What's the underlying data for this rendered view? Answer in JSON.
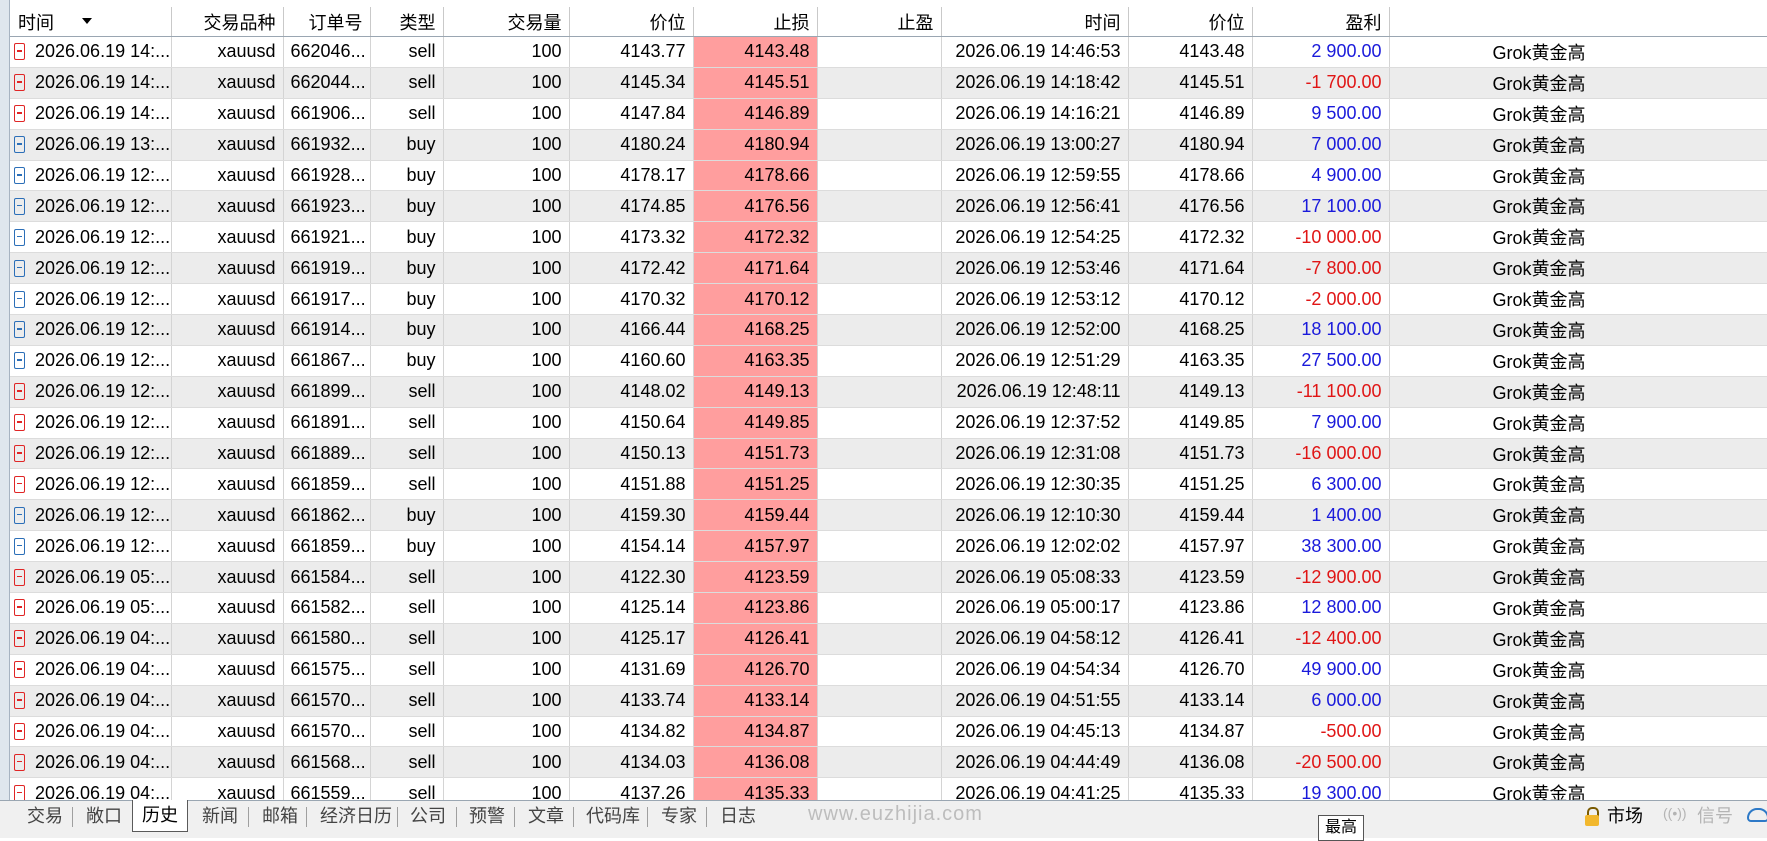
{
  "columns": [
    "时间",
    "交易品种",
    "订单号",
    "类型",
    "交易量",
    "价位",
    "止损",
    "止盈",
    "时间",
    "价位",
    "盈利",
    ""
  ],
  "rows": [
    {
      "open_time": "2026.06.19 14:...",
      "symbol": "xauusd",
      "order": "662046...",
      "type": "sell",
      "volume": "100",
      "open_price": "4143.77",
      "sl": "4143.48",
      "tp": "",
      "close_time": "2026.06.19 14:46:53",
      "close_price": "4143.48",
      "profit": "2 900.00",
      "profit_sign": "pos",
      "comment": "Grok黄金高"
    },
    {
      "open_time": "2026.06.19 14:...",
      "symbol": "xauusd",
      "order": "662044...",
      "type": "sell",
      "volume": "100",
      "open_price": "4145.34",
      "sl": "4145.51",
      "tp": "",
      "close_time": "2026.06.19 14:18:42",
      "close_price": "4145.51",
      "profit": "-1 700.00",
      "profit_sign": "neg",
      "comment": "Grok黄金高"
    },
    {
      "open_time": "2026.06.19 14:...",
      "symbol": "xauusd",
      "order": "661906...",
      "type": "sell",
      "volume": "100",
      "open_price": "4147.84",
      "sl": "4146.89",
      "tp": "",
      "close_time": "2026.06.19 14:16:21",
      "close_price": "4146.89",
      "profit": "9 500.00",
      "profit_sign": "pos",
      "comment": "Grok黄金高"
    },
    {
      "open_time": "2026.06.19 13:...",
      "symbol": "xauusd",
      "order": "661932...",
      "type": "buy",
      "volume": "100",
      "open_price": "4180.24",
      "sl": "4180.94",
      "tp": "",
      "close_time": "2026.06.19 13:00:27",
      "close_price": "4180.94",
      "profit": "7 000.00",
      "profit_sign": "pos",
      "comment": "Grok黄金高"
    },
    {
      "open_time": "2026.06.19 12:...",
      "symbol": "xauusd",
      "order": "661928...",
      "type": "buy",
      "volume": "100",
      "open_price": "4178.17",
      "sl": "4178.66",
      "tp": "",
      "close_time": "2026.06.19 12:59:55",
      "close_price": "4178.66",
      "profit": "4 900.00",
      "profit_sign": "pos",
      "comment": "Grok黄金高"
    },
    {
      "open_time": "2026.06.19 12:...",
      "symbol": "xauusd",
      "order": "661923...",
      "type": "buy",
      "volume": "100",
      "open_price": "4174.85",
      "sl": "4176.56",
      "tp": "",
      "close_time": "2026.06.19 12:56:41",
      "close_price": "4176.56",
      "profit": "17 100.00",
      "profit_sign": "pos",
      "comment": "Grok黄金高"
    },
    {
      "open_time": "2026.06.19 12:...",
      "symbol": "xauusd",
      "order": "661921...",
      "type": "buy",
      "volume": "100",
      "open_price": "4173.32",
      "sl": "4172.32",
      "tp": "",
      "close_time": "2026.06.19 12:54:25",
      "close_price": "4172.32",
      "profit": "-10 000.00",
      "profit_sign": "neg",
      "comment": "Grok黄金高"
    },
    {
      "open_time": "2026.06.19 12:...",
      "symbol": "xauusd",
      "order": "661919...",
      "type": "buy",
      "volume": "100",
      "open_price": "4172.42",
      "sl": "4171.64",
      "tp": "",
      "close_time": "2026.06.19 12:53:46",
      "close_price": "4171.64",
      "profit": "-7 800.00",
      "profit_sign": "neg",
      "comment": "Grok黄金高"
    },
    {
      "open_time": "2026.06.19 12:...",
      "symbol": "xauusd",
      "order": "661917...",
      "type": "buy",
      "volume": "100",
      "open_price": "4170.32",
      "sl": "4170.12",
      "tp": "",
      "close_time": "2026.06.19 12:53:12",
      "close_price": "4170.12",
      "profit": "-2 000.00",
      "profit_sign": "neg",
      "comment": "Grok黄金高"
    },
    {
      "open_time": "2026.06.19 12:...",
      "symbol": "xauusd",
      "order": "661914...",
      "type": "buy",
      "volume": "100",
      "open_price": "4166.44",
      "sl": "4168.25",
      "tp": "",
      "close_time": "2026.06.19 12:52:00",
      "close_price": "4168.25",
      "profit": "18 100.00",
      "profit_sign": "pos",
      "comment": "Grok黄金高"
    },
    {
      "open_time": "2026.06.19 12:...",
      "symbol": "xauusd",
      "order": "661867...",
      "type": "buy",
      "volume": "100",
      "open_price": "4160.60",
      "sl": "4163.35",
      "tp": "",
      "close_time": "2026.06.19 12:51:29",
      "close_price": "4163.35",
      "profit": "27 500.00",
      "profit_sign": "pos",
      "comment": "Grok黄金高"
    },
    {
      "open_time": "2026.06.19 12:...",
      "symbol": "xauusd",
      "order": "661899...",
      "type": "sell",
      "volume": "100",
      "open_price": "4148.02",
      "sl": "4149.13",
      "tp": "",
      "close_time": "2026.06.19 12:48:11",
      "close_price": "4149.13",
      "profit": "-11 100.00",
      "profit_sign": "neg",
      "comment": "Grok黄金高"
    },
    {
      "open_time": "2026.06.19 12:...",
      "symbol": "xauusd",
      "order": "661891...",
      "type": "sell",
      "volume": "100",
      "open_price": "4150.64",
      "sl": "4149.85",
      "tp": "",
      "close_time": "2026.06.19 12:37:52",
      "close_price": "4149.85",
      "profit": "7 900.00",
      "profit_sign": "pos",
      "comment": "Grok黄金高"
    },
    {
      "open_time": "2026.06.19 12:...",
      "symbol": "xauusd",
      "order": "661889...",
      "type": "sell",
      "volume": "100",
      "open_price": "4150.13",
      "sl": "4151.73",
      "tp": "",
      "close_time": "2026.06.19 12:31:08",
      "close_price": "4151.73",
      "profit": "-16 000.00",
      "profit_sign": "neg",
      "comment": "Grok黄金高"
    },
    {
      "open_time": "2026.06.19 12:...",
      "symbol": "xauusd",
      "order": "661859...",
      "type": "sell",
      "volume": "100",
      "open_price": "4151.88",
      "sl": "4151.25",
      "tp": "",
      "close_time": "2026.06.19 12:30:35",
      "close_price": "4151.25",
      "profit": "6 300.00",
      "profit_sign": "pos",
      "comment": "Grok黄金高"
    },
    {
      "open_time": "2026.06.19 12:...",
      "symbol": "xauusd",
      "order": "661862...",
      "type": "buy",
      "volume": "100",
      "open_price": "4159.30",
      "sl": "4159.44",
      "tp": "",
      "close_time": "2026.06.19 12:10:30",
      "close_price": "4159.44",
      "profit": "1 400.00",
      "profit_sign": "pos",
      "comment": "Grok黄金高"
    },
    {
      "open_time": "2026.06.19 12:...",
      "symbol": "xauusd",
      "order": "661859...",
      "type": "buy",
      "volume": "100",
      "open_price": "4154.14",
      "sl": "4157.97",
      "tp": "",
      "close_time": "2026.06.19 12:02:02",
      "close_price": "4157.97",
      "profit": "38 300.00",
      "profit_sign": "pos",
      "comment": "Grok黄金高"
    },
    {
      "open_time": "2026.06.19 05:...",
      "symbol": "xauusd",
      "order": "661584...",
      "type": "sell",
      "volume": "100",
      "open_price": "4122.30",
      "sl": "4123.59",
      "tp": "",
      "close_time": "2026.06.19 05:08:33",
      "close_price": "4123.59",
      "profit": "-12 900.00",
      "profit_sign": "neg",
      "comment": "Grok黄金高"
    },
    {
      "open_time": "2026.06.19 05:...",
      "symbol": "xauusd",
      "order": "661582...",
      "type": "sell",
      "volume": "100",
      "open_price": "4125.14",
      "sl": "4123.86",
      "tp": "",
      "close_time": "2026.06.19 05:00:17",
      "close_price": "4123.86",
      "profit": "12 800.00",
      "profit_sign": "pos",
      "comment": "Grok黄金高"
    },
    {
      "open_time": "2026.06.19 04:...",
      "symbol": "xauusd",
      "order": "661580...",
      "type": "sell",
      "volume": "100",
      "open_price": "4125.17",
      "sl": "4126.41",
      "tp": "",
      "close_time": "2026.06.19 04:58:12",
      "close_price": "4126.41",
      "profit": "-12 400.00",
      "profit_sign": "neg",
      "comment": "Grok黄金高"
    },
    {
      "open_time": "2026.06.19 04:...",
      "symbol": "xauusd",
      "order": "661575...",
      "type": "sell",
      "volume": "100",
      "open_price": "4131.69",
      "sl": "4126.70",
      "tp": "",
      "close_time": "2026.06.19 04:54:34",
      "close_price": "4126.70",
      "profit": "49 900.00",
      "profit_sign": "pos",
      "comment": "Grok黄金高"
    },
    {
      "open_time": "2026.06.19 04:...",
      "symbol": "xauusd",
      "order": "661570...",
      "type": "sell",
      "volume": "100",
      "open_price": "4133.74",
      "sl": "4133.14",
      "tp": "",
      "close_time": "2026.06.19 04:51:55",
      "close_price": "4133.14",
      "profit": "6 000.00",
      "profit_sign": "pos",
      "comment": "Grok黄金高"
    },
    {
      "open_time": "2026.06.19 04:...",
      "symbol": "xauusd",
      "order": "661570...",
      "type": "sell",
      "volume": "100",
      "open_price": "4134.82",
      "sl": "4134.87",
      "tp": "",
      "close_time": "2026.06.19 04:45:13",
      "close_price": "4134.87",
      "profit": "-500.00",
      "profit_sign": "neg",
      "comment": "Grok黄金高"
    },
    {
      "open_time": "2026.06.19 04:...",
      "symbol": "xauusd",
      "order": "661568...",
      "type": "sell",
      "volume": "100",
      "open_price": "4134.03",
      "sl": "4136.08",
      "tp": "",
      "close_time": "2026.06.19 04:44:49",
      "close_price": "4136.08",
      "profit": "-20 500.00",
      "profit_sign": "neg",
      "comment": "Grok黄金高"
    },
    {
      "open_time": "2026.06.19 04:...",
      "symbol": "xauusd",
      "order": "661559...",
      "type": "sell",
      "volume": "100",
      "open_price": "4137.26",
      "sl": "4135.33",
      "tp": "",
      "close_time": "2026.06.19 04:41:25",
      "close_price": "4135.33",
      "profit": "19 300.00",
      "profit_sign": "pos",
      "comment": "Grok黄金高"
    }
  ],
  "tabs": [
    "交易",
    "敞口",
    "历史",
    "新闻",
    "邮箱",
    "经济日历",
    "公司",
    "预警",
    "文章",
    "代码库",
    "专家",
    "日志"
  ],
  "active_tab": "历史",
  "status": {
    "market": "市场",
    "signal": "信号",
    "tooltip": "最高"
  },
  "watermark": "www.euzhijia.com",
  "colors": {
    "stop_loss_bg": "#ff9e9e",
    "profit_pos": "#1a1adb",
    "profit_neg": "#e01515",
    "sell_icon": "#e02525",
    "buy_icon": "#2c6fb8"
  }
}
